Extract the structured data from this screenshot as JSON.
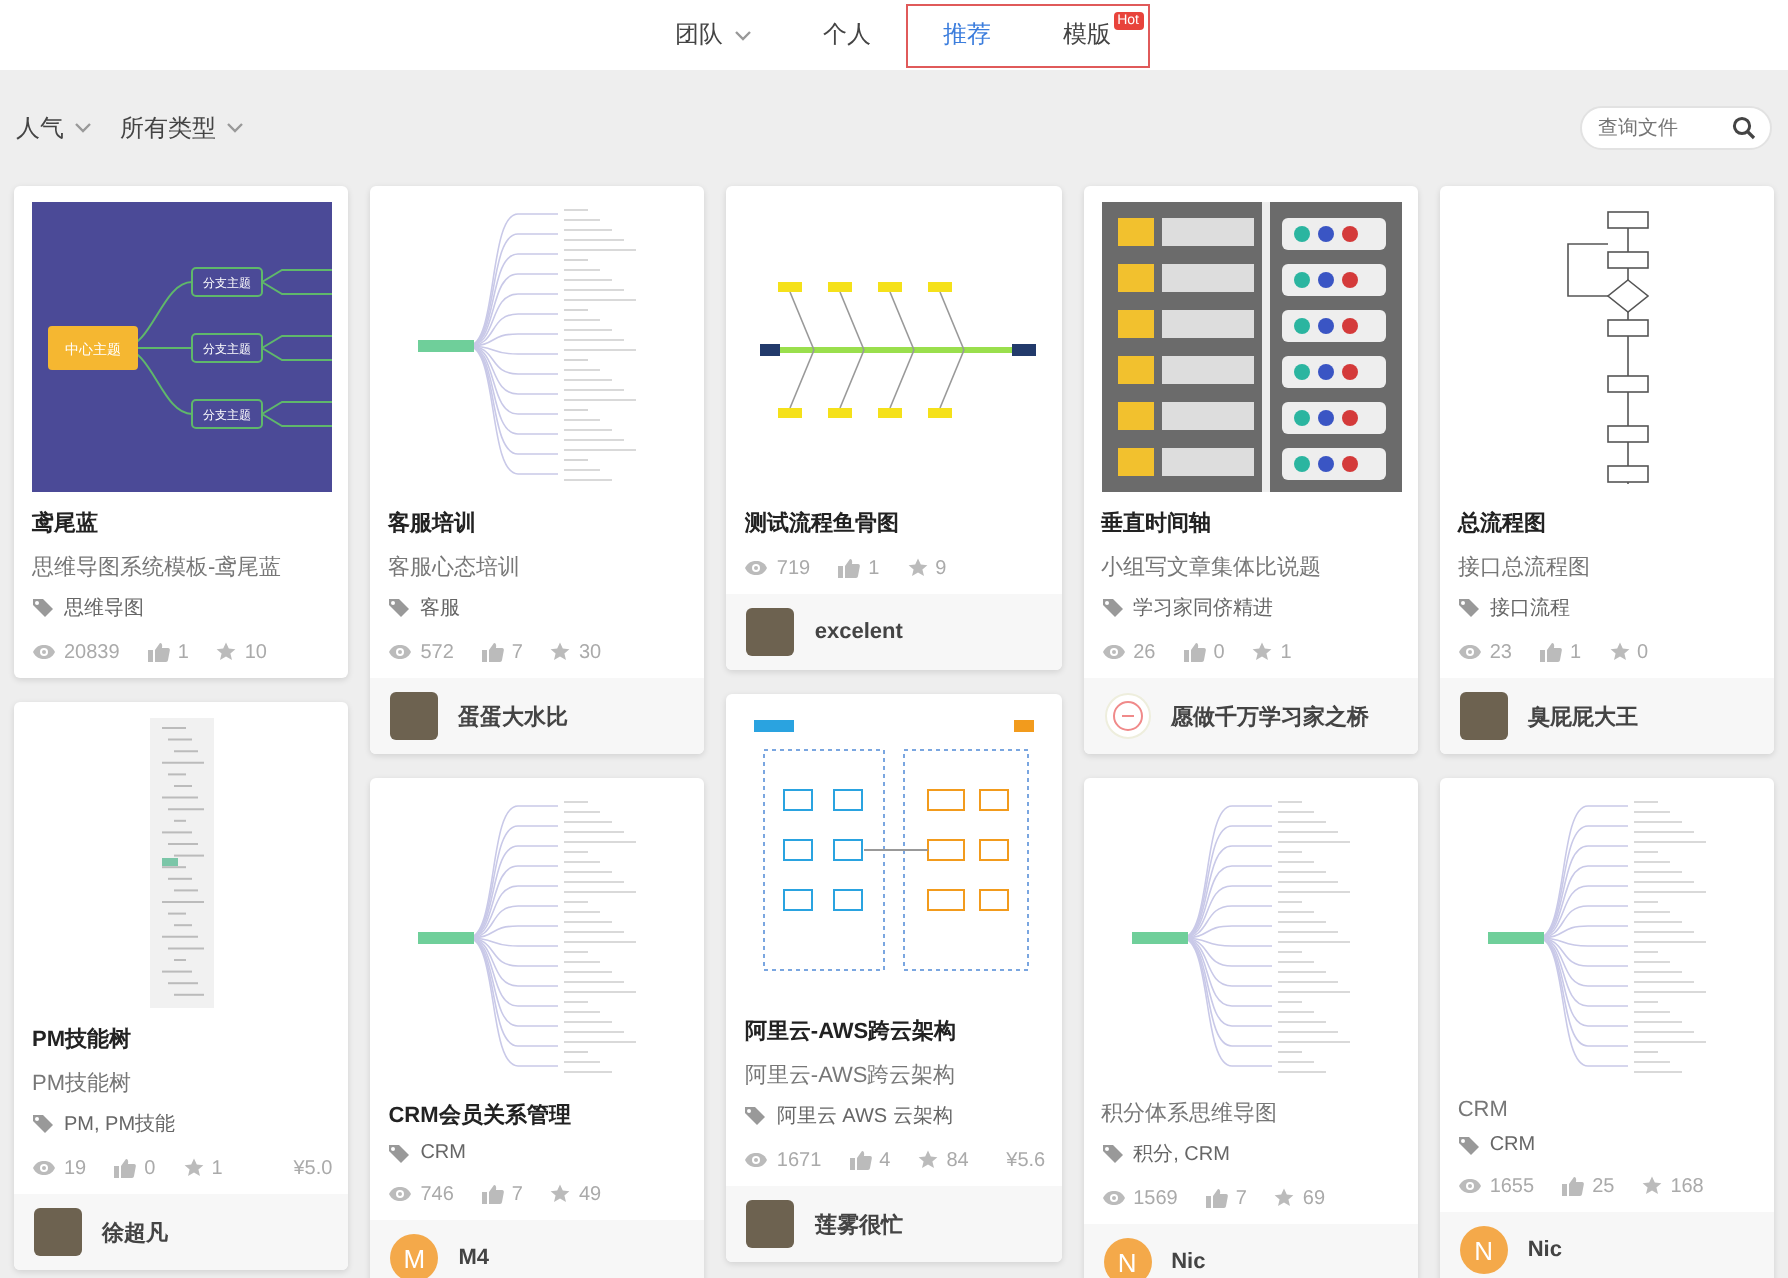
{
  "tabs": [
    {
      "label": "团队",
      "has_menu": true,
      "selected": false
    },
    {
      "label": "个人",
      "has_menu": false,
      "selected": false
    },
    {
      "label": "推荐",
      "has_menu": false,
      "selected": true
    },
    {
      "label": "模版",
      "has_menu": false,
      "selected": false,
      "badge": "Hot"
    }
  ],
  "filters": [
    {
      "label": "人气"
    },
    {
      "label": "所有类型"
    }
  ],
  "search": {
    "placeholder": "查询文件"
  },
  "columns": [
    {
      "cards": [
        {
          "thumbnail": {
            "kind": "mindmap_banner",
            "center": "中心主题",
            "branches": [
              "分支主题",
              "分支主题",
              "分支主题"
            ]
          },
          "title": "鸢尾蓝",
          "description": "思维导图系统模板-鸢尾蓝",
          "tags": "思维导图",
          "views": "20839",
          "likes": "1",
          "favorites": "10"
        },
        {
          "thumbnail": {
            "kind": "vertical_tree"
          },
          "title": "PM技能树",
          "description": "PM技能树",
          "tags": "PM, PM技能",
          "views": "19",
          "likes": "0",
          "favorites": "1",
          "price": "¥5.0",
          "author": {
            "name": "徐超凡",
            "kind": "photo"
          }
        }
      ]
    },
    {
      "cards": [
        {
          "thumbnail": {
            "kind": "mindmap_tree"
          },
          "title": "客服培训",
          "description": "客服心态培训",
          "tags": "客服",
          "views": "572",
          "likes": "7",
          "favorites": "30",
          "author": {
            "name": "蛋蛋大水比",
            "kind": "photo"
          }
        },
        {
          "thumbnail": {
            "kind": "mindmap_tree"
          },
          "title": "CRM会员关系管理",
          "tags": "CRM",
          "views": "746",
          "likes": "7",
          "favorites": "49",
          "author": {
            "name": "M4",
            "kind": "letter",
            "letter": "M"
          }
        }
      ]
    },
    {
      "cards": [
        {
          "thumbnail": {
            "kind": "fishbone"
          },
          "title": "测试流程鱼骨图",
          "views": "719",
          "likes": "1",
          "favorites": "9",
          "author": {
            "name": "excelent",
            "kind": "photo"
          }
        },
        {
          "thumbnail": {
            "kind": "architecture"
          },
          "title": "阿里云-AWS跨云架构",
          "description": "阿里云-AWS跨云架构",
          "tags": "阿里云 AWS 云架构",
          "views": "1671",
          "likes": "4",
          "favorites": "84",
          "price": "¥5.6",
          "author": {
            "name": "莲雾很忙",
            "kind": "photo"
          }
        }
      ]
    },
    {
      "cards": [
        {
          "thumbnail": {
            "kind": "timeline"
          },
          "title": "垂直时间轴",
          "description": "小组写文章集体比说题",
          "tags": "学习家同侪精进",
          "views": "26",
          "likes": "0",
          "favorites": "1",
          "author": {
            "name": "愿做千万学习家之桥",
            "kind": "icon"
          }
        },
        {
          "thumbnail": {
            "kind": "mindmap_tree"
          },
          "description": "积分体系思维导图",
          "tags": "积分, CRM",
          "views": "1569",
          "likes": "7",
          "favorites": "69",
          "author": {
            "name": "Nic",
            "kind": "letter",
            "letter": "N"
          }
        }
      ]
    },
    {
      "cards": [
        {
          "thumbnail": {
            "kind": "flowchart"
          },
          "title": "总流程图",
          "description": "接口总流程图",
          "tags": "接口流程",
          "views": "23",
          "likes": "1",
          "favorites": "0",
          "author": {
            "name": "臭屁屁大王",
            "kind": "photo"
          }
        },
        {
          "thumbnail": {
            "kind": "mindmap_tree"
          },
          "description": "CRM",
          "tags": "CRM",
          "views": "1655",
          "likes": "25",
          "favorites": "168",
          "author": {
            "name": "Nic",
            "kind": "letter",
            "letter": "N"
          }
        }
      ]
    }
  ]
}
